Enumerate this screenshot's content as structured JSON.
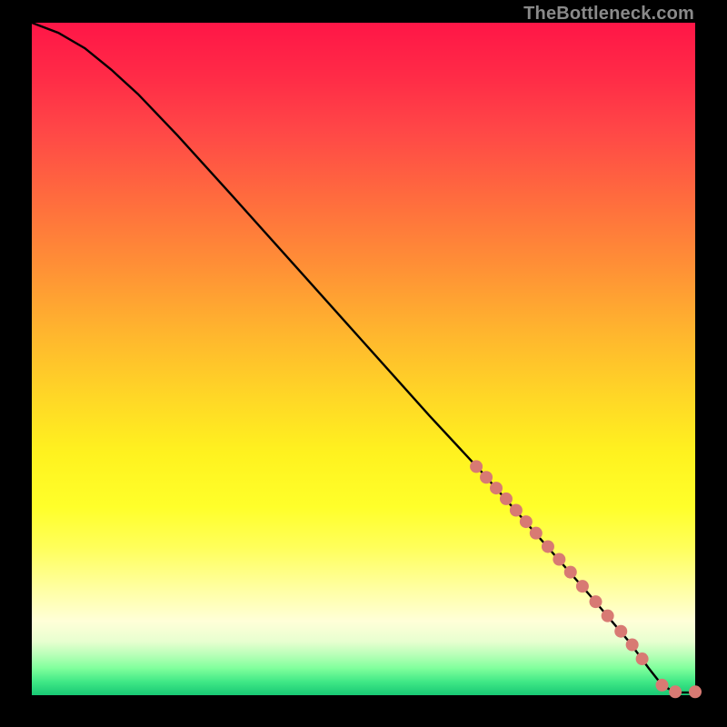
{
  "watermark": "TheBottleneck.com",
  "chart_data": {
    "type": "line",
    "title": "",
    "xlabel": "",
    "ylabel": "",
    "xlim": [
      0,
      100
    ],
    "ylim": [
      0,
      100
    ],
    "gradient_background": true,
    "curve": {
      "name": "main-curve",
      "color": "#000000",
      "points": [
        {
          "x": 0,
          "y": 100
        },
        {
          "x": 4,
          "y": 98.5
        },
        {
          "x": 8,
          "y": 96.2
        },
        {
          "x": 12,
          "y": 93.0
        },
        {
          "x": 16,
          "y": 89.4
        },
        {
          "x": 22,
          "y": 83.2
        },
        {
          "x": 30,
          "y": 74.5
        },
        {
          "x": 40,
          "y": 63.5
        },
        {
          "x": 50,
          "y": 52.5
        },
        {
          "x": 60,
          "y": 41.5
        },
        {
          "x": 68,
          "y": 33.0
        },
        {
          "x": 76,
          "y": 24.0
        },
        {
          "x": 84,
          "y": 15.0
        },
        {
          "x": 90,
          "y": 8.0
        },
        {
          "x": 93,
          "y": 4.0
        },
        {
          "x": 95,
          "y": 1.5
        },
        {
          "x": 97,
          "y": 0.4
        },
        {
          "x": 100,
          "y": 0.4
        }
      ]
    },
    "markers": {
      "name": "highlight-points",
      "color": "#d87a73",
      "radius": 7,
      "points": [
        {
          "x": 67.0,
          "y": 34.0
        },
        {
          "x": 68.5,
          "y": 32.4
        },
        {
          "x": 70.0,
          "y": 30.8
        },
        {
          "x": 71.5,
          "y": 29.2
        },
        {
          "x": 73.0,
          "y": 27.5
        },
        {
          "x": 74.5,
          "y": 25.8
        },
        {
          "x": 76.0,
          "y": 24.1
        },
        {
          "x": 77.8,
          "y": 22.1
        },
        {
          "x": 79.5,
          "y": 20.2
        },
        {
          "x": 81.2,
          "y": 18.3
        },
        {
          "x": 83.0,
          "y": 16.2
        },
        {
          "x": 85.0,
          "y": 13.9
        },
        {
          "x": 86.8,
          "y": 11.8
        },
        {
          "x": 88.8,
          "y": 9.5
        },
        {
          "x": 90.5,
          "y": 7.5
        },
        {
          "x": 92.0,
          "y": 5.4
        },
        {
          "x": 95.0,
          "y": 1.5
        },
        {
          "x": 97.0,
          "y": 0.5
        },
        {
          "x": 100.0,
          "y": 0.5
        }
      ]
    }
  }
}
